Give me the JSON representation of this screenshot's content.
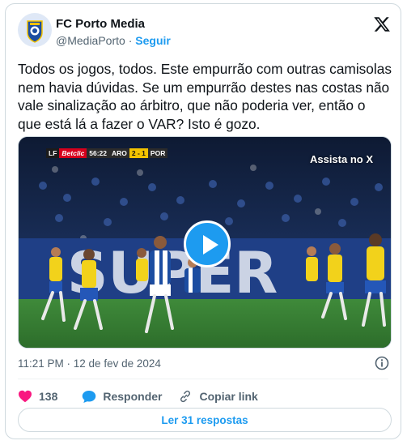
{
  "author": {
    "name": "FC Porto Media",
    "handle": "@MediaPorto",
    "separator": "·",
    "follow_label": "Seguir",
    "avatar_icon": "fc-porto-crest-icon"
  },
  "tweet": {
    "text": "Todos os jogos, todos. Este empurrão com outras camisolas nem havia dúvidas. Se um empurrão destes nas costas não vale sinalização ao árbitro, que não poderia ver, então o que está lá a fazer o VAR? Isto é gozo.",
    "timestamp": "11:21 PM · 12 de fev de 2024"
  },
  "media": {
    "overlay_label": "Assista no X",
    "play_icon": "play-icon",
    "scoreboard": {
      "channel": "LF",
      "sponsor": "Betclic",
      "clock": "56:22",
      "home": "ARO",
      "score": "2 - 1",
      "away": "POR"
    },
    "banner_text": "SUPER"
  },
  "actions": {
    "like_count": "138",
    "reply_label": "Responder",
    "copy_label": "Copiar link"
  },
  "footer": {
    "read_replies_label": "Ler 31 respostas"
  },
  "colors": {
    "accent": "#1d9bf0",
    "like": "#f91880",
    "text": "#0f1419",
    "muted": "#536471"
  }
}
